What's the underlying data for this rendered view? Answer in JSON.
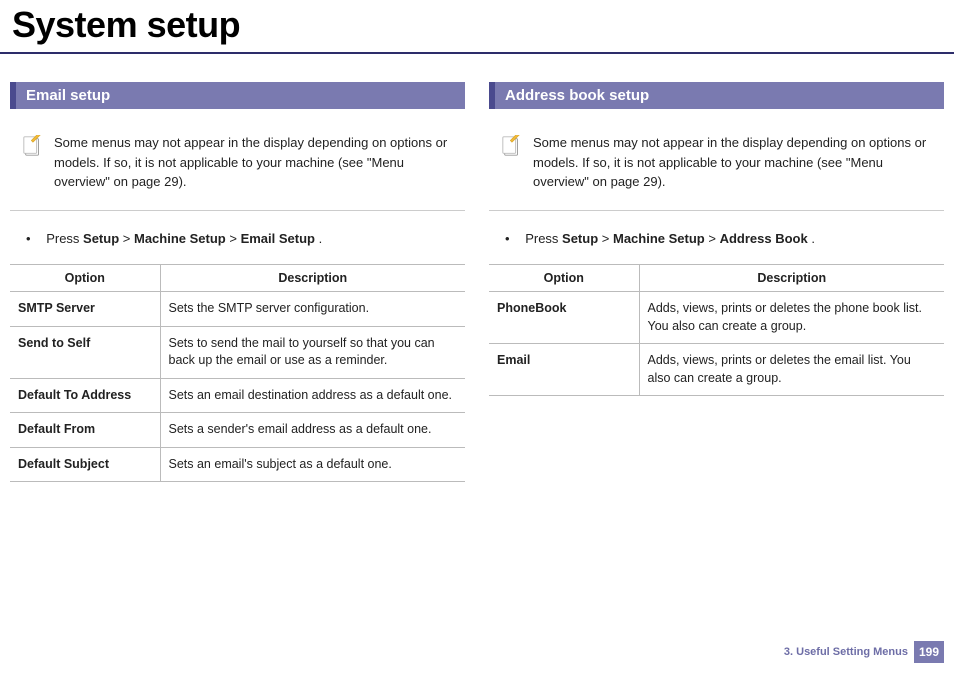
{
  "title": "System setup",
  "left": {
    "heading": "Email setup",
    "note": "Some menus may not appear in the display depending on options or models. If so, it is not applicable to your machine (see \"Menu overview\" on page 29).",
    "press": "Press ",
    "path_a": "Setup",
    "path_b": "Machine Setup",
    "path_c": "Email Setup",
    "sep": " > ",
    "period": " .",
    "th_option": "Option",
    "th_desc": "Description",
    "rows": [
      {
        "opt": "SMTP Server",
        "desc": "Sets the SMTP server configuration."
      },
      {
        "opt": "Send to Self",
        "desc": "Sets to send the mail to yourself so that you can back up the email or use as a reminder."
      },
      {
        "opt": "Default To Address",
        "desc": "Sets an email destination address as a default one."
      },
      {
        "opt": "Default From",
        "desc": "Sets a sender's email address as a default one."
      },
      {
        "opt": "Default Subject",
        "desc": "Sets an email's subject as a default one."
      }
    ]
  },
  "right": {
    "heading": "Address book setup",
    "note": "Some menus may not appear in the display depending on options or models. If so, it is not applicable to your machine (see \"Menu overview\" on page 29).",
    "press": "Press ",
    "path_a": "Setup",
    "path_b": "Machine Setup",
    "path_c": "Address Book",
    "sep": " > ",
    "period": " .",
    "th_option": "Option",
    "th_desc": "Description",
    "rows": [
      {
        "opt": "PhoneBook",
        "desc": "Adds, views, prints or deletes the phone book list. You also can create a group."
      },
      {
        "opt": "Email",
        "desc": "Adds, views, prints or deletes the email list. You also can create a group."
      }
    ]
  },
  "footer": {
    "chapter": "3.  Useful Setting Menus",
    "page": "199"
  }
}
